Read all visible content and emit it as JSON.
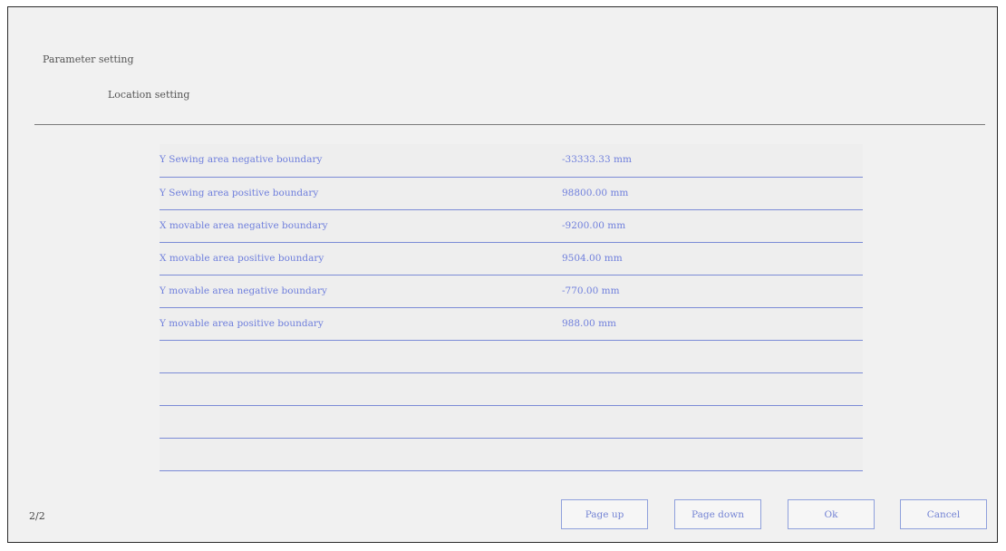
{
  "header": {
    "title": "Parameter setting",
    "subtitle": "Location setting"
  },
  "params": [
    {
      "name": "Y Sewing area negative boundary",
      "value": "-33333.33 mm"
    },
    {
      "name": "Y Sewing area positive boundary",
      "value": "98800.00 mm"
    },
    {
      "name": "X movable area negative boundary",
      "value": "-9200.00 mm"
    },
    {
      "name": "X movable area positive boundary",
      "value": "9504.00 mm"
    },
    {
      "name": "Y movable area negative boundary",
      "value": "-770.00 mm"
    },
    {
      "name": "Y movable area positive boundary",
      "value": "988.00 mm"
    },
    {
      "name": "",
      "value": ""
    },
    {
      "name": "",
      "value": ""
    },
    {
      "name": "",
      "value": ""
    },
    {
      "name": "",
      "value": ""
    }
  ],
  "footer": {
    "page_indicator": "2/2",
    "page_up_label": "Page up",
    "page_down_label": "Page down",
    "ok_label": "Ok",
    "cancel_label": "Cancel"
  },
  "colors": {
    "accent": "#6f7fdc",
    "row_divider": "#7b8bd6",
    "background": "#f1f1f1"
  }
}
